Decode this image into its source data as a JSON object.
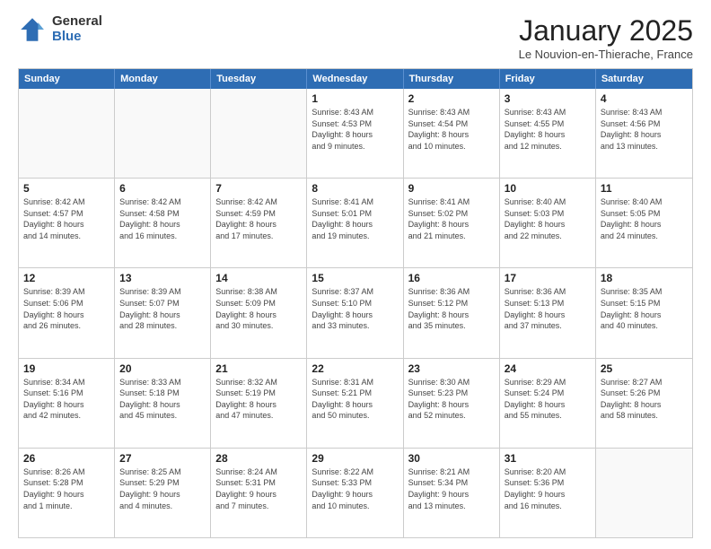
{
  "logo": {
    "general": "General",
    "blue": "Blue"
  },
  "title": "January 2025",
  "subtitle": "Le Nouvion-en-Thierache, France",
  "header": {
    "days": [
      "Sunday",
      "Monday",
      "Tuesday",
      "Wednesday",
      "Thursday",
      "Friday",
      "Saturday"
    ]
  },
  "weeks": [
    {
      "cells": [
        {
          "day": "",
          "info": "",
          "empty": true
        },
        {
          "day": "",
          "info": "",
          "empty": true
        },
        {
          "day": "",
          "info": "",
          "empty": true
        },
        {
          "day": "1",
          "info": "Sunrise: 8:43 AM\nSunset: 4:53 PM\nDaylight: 8 hours\nand 9 minutes."
        },
        {
          "day": "2",
          "info": "Sunrise: 8:43 AM\nSunset: 4:54 PM\nDaylight: 8 hours\nand 10 minutes."
        },
        {
          "day": "3",
          "info": "Sunrise: 8:43 AM\nSunset: 4:55 PM\nDaylight: 8 hours\nand 12 minutes."
        },
        {
          "day": "4",
          "info": "Sunrise: 8:43 AM\nSunset: 4:56 PM\nDaylight: 8 hours\nand 13 minutes."
        }
      ]
    },
    {
      "cells": [
        {
          "day": "5",
          "info": "Sunrise: 8:42 AM\nSunset: 4:57 PM\nDaylight: 8 hours\nand 14 minutes."
        },
        {
          "day": "6",
          "info": "Sunrise: 8:42 AM\nSunset: 4:58 PM\nDaylight: 8 hours\nand 16 minutes."
        },
        {
          "day": "7",
          "info": "Sunrise: 8:42 AM\nSunset: 4:59 PM\nDaylight: 8 hours\nand 17 minutes."
        },
        {
          "day": "8",
          "info": "Sunrise: 8:41 AM\nSunset: 5:01 PM\nDaylight: 8 hours\nand 19 minutes."
        },
        {
          "day": "9",
          "info": "Sunrise: 8:41 AM\nSunset: 5:02 PM\nDaylight: 8 hours\nand 21 minutes."
        },
        {
          "day": "10",
          "info": "Sunrise: 8:40 AM\nSunset: 5:03 PM\nDaylight: 8 hours\nand 22 minutes."
        },
        {
          "day": "11",
          "info": "Sunrise: 8:40 AM\nSunset: 5:05 PM\nDaylight: 8 hours\nand 24 minutes."
        }
      ]
    },
    {
      "cells": [
        {
          "day": "12",
          "info": "Sunrise: 8:39 AM\nSunset: 5:06 PM\nDaylight: 8 hours\nand 26 minutes."
        },
        {
          "day": "13",
          "info": "Sunrise: 8:39 AM\nSunset: 5:07 PM\nDaylight: 8 hours\nand 28 minutes."
        },
        {
          "day": "14",
          "info": "Sunrise: 8:38 AM\nSunset: 5:09 PM\nDaylight: 8 hours\nand 30 minutes."
        },
        {
          "day": "15",
          "info": "Sunrise: 8:37 AM\nSunset: 5:10 PM\nDaylight: 8 hours\nand 33 minutes."
        },
        {
          "day": "16",
          "info": "Sunrise: 8:36 AM\nSunset: 5:12 PM\nDaylight: 8 hours\nand 35 minutes."
        },
        {
          "day": "17",
          "info": "Sunrise: 8:36 AM\nSunset: 5:13 PM\nDaylight: 8 hours\nand 37 minutes."
        },
        {
          "day": "18",
          "info": "Sunrise: 8:35 AM\nSunset: 5:15 PM\nDaylight: 8 hours\nand 40 minutes."
        }
      ]
    },
    {
      "cells": [
        {
          "day": "19",
          "info": "Sunrise: 8:34 AM\nSunset: 5:16 PM\nDaylight: 8 hours\nand 42 minutes."
        },
        {
          "day": "20",
          "info": "Sunrise: 8:33 AM\nSunset: 5:18 PM\nDaylight: 8 hours\nand 45 minutes."
        },
        {
          "day": "21",
          "info": "Sunrise: 8:32 AM\nSunset: 5:19 PM\nDaylight: 8 hours\nand 47 minutes."
        },
        {
          "day": "22",
          "info": "Sunrise: 8:31 AM\nSunset: 5:21 PM\nDaylight: 8 hours\nand 50 minutes."
        },
        {
          "day": "23",
          "info": "Sunrise: 8:30 AM\nSunset: 5:23 PM\nDaylight: 8 hours\nand 52 minutes."
        },
        {
          "day": "24",
          "info": "Sunrise: 8:29 AM\nSunset: 5:24 PM\nDaylight: 8 hours\nand 55 minutes."
        },
        {
          "day": "25",
          "info": "Sunrise: 8:27 AM\nSunset: 5:26 PM\nDaylight: 8 hours\nand 58 minutes."
        }
      ]
    },
    {
      "cells": [
        {
          "day": "26",
          "info": "Sunrise: 8:26 AM\nSunset: 5:28 PM\nDaylight: 9 hours\nand 1 minute."
        },
        {
          "day": "27",
          "info": "Sunrise: 8:25 AM\nSunset: 5:29 PM\nDaylight: 9 hours\nand 4 minutes."
        },
        {
          "day": "28",
          "info": "Sunrise: 8:24 AM\nSunset: 5:31 PM\nDaylight: 9 hours\nand 7 minutes."
        },
        {
          "day": "29",
          "info": "Sunrise: 8:22 AM\nSunset: 5:33 PM\nDaylight: 9 hours\nand 10 minutes."
        },
        {
          "day": "30",
          "info": "Sunrise: 8:21 AM\nSunset: 5:34 PM\nDaylight: 9 hours\nand 13 minutes."
        },
        {
          "day": "31",
          "info": "Sunrise: 8:20 AM\nSunset: 5:36 PM\nDaylight: 9 hours\nand 16 minutes."
        },
        {
          "day": "",
          "info": "",
          "empty": true
        }
      ]
    }
  ]
}
